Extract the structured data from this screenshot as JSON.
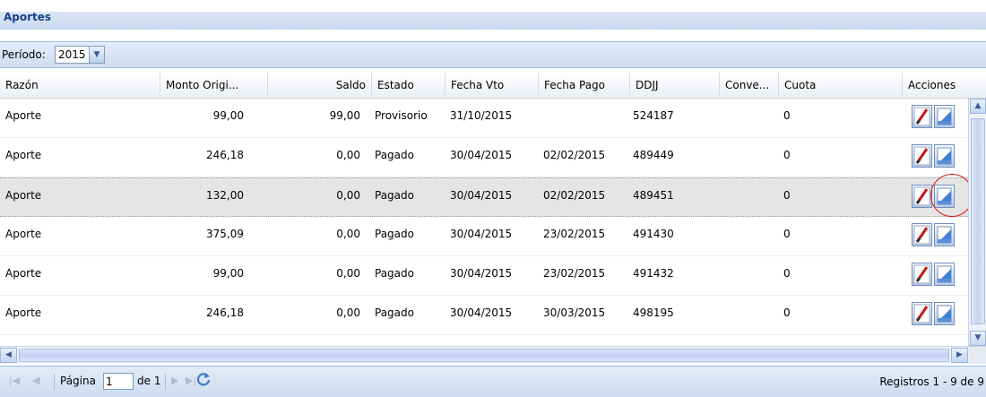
{
  "panel": {
    "title": "Aportes"
  },
  "filter": {
    "label": "Período:",
    "year": "2015"
  },
  "columns": [
    "Razón",
    "Monto Origi...",
    "Saldo",
    "Estado",
    "Fecha Vto",
    "Fecha Pago",
    "DDJJ",
    "Conve...",
    "Cuota",
    "Acciones"
  ],
  "rows": [
    {
      "razon": "Aporte",
      "monto": "99,00",
      "saldo": "99,00",
      "estado": "Provisorio",
      "fecha_vto": "31/10/2015",
      "fecha_pago": "",
      "ddjj": "524187",
      "conve": "",
      "cuota": "0"
    },
    {
      "razon": "Aporte",
      "monto": "246,18",
      "saldo": "0,00",
      "estado": "Pagado",
      "fecha_vto": "30/04/2015",
      "fecha_pago": "02/02/2015",
      "ddjj": "489449",
      "conve": "",
      "cuota": "0"
    },
    {
      "razon": "Aporte",
      "monto": "132,00",
      "saldo": "0,00",
      "estado": "Pagado",
      "fecha_vto": "30/04/2015",
      "fecha_pago": "02/02/2015",
      "ddjj": "489451",
      "conve": "",
      "cuota": "0"
    },
    {
      "razon": "Aporte",
      "monto": "375,09",
      "saldo": "0,00",
      "estado": "Pagado",
      "fecha_vto": "30/04/2015",
      "fecha_pago": "23/02/2015",
      "ddjj": "491430",
      "conve": "",
      "cuota": "0"
    },
    {
      "razon": "Aporte",
      "monto": "99,00",
      "saldo": "0,00",
      "estado": "Pagado",
      "fecha_vto": "30/04/2015",
      "fecha_pago": "23/02/2015",
      "ddjj": "491432",
      "conve": "",
      "cuota": "0"
    },
    {
      "razon": "Aporte",
      "monto": "246,18",
      "saldo": "0,00",
      "estado": "Pagado",
      "fecha_vto": "30/04/2015",
      "fecha_pago": "30/03/2015",
      "ddjj": "498195",
      "conve": "",
      "cuota": "0"
    }
  ],
  "selected_row": 2,
  "pager": {
    "page_label": "Página",
    "page_value": "1",
    "of_label": "de 1",
    "records": "Registros 1 - 9 de 9"
  },
  "icons": {
    "first": "first-page-icon",
    "prev": "prev-page-icon",
    "next": "next-page-icon",
    "last": "last-page-icon",
    "refresh": "refresh-icon",
    "edit": "edit-icon",
    "print": "print-icon"
  },
  "colors": {
    "header_text": "#15428b",
    "toolbar": "#d0def1",
    "selected_row": "#e5e5e5",
    "highlight": "#e01010"
  }
}
